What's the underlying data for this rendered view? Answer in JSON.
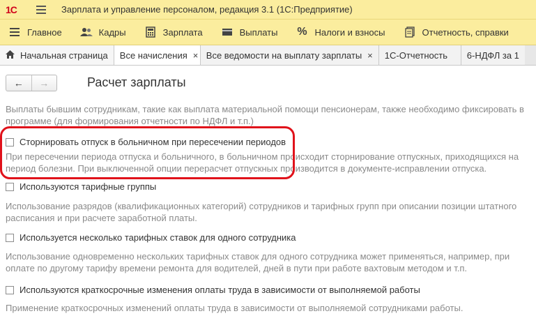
{
  "window": {
    "logo_text": "1С",
    "title": "Зарплата и управление персоналом, редакция 3.1  (1С:Предприятие)"
  },
  "menu": [
    {
      "label": "Главное",
      "icon": "hamburger-icon"
    },
    {
      "label": "Кадры",
      "icon": "users-icon"
    },
    {
      "label": "Зарплата",
      "icon": "calculator-icon"
    },
    {
      "label": "Выплаты",
      "icon": "wallet-icon"
    },
    {
      "label": "Налоги и взносы",
      "icon": "percent-icon"
    },
    {
      "label": "Отчетность, справки",
      "icon": "document-icon"
    }
  ],
  "tabs": [
    {
      "label": "Начальная страница",
      "icon": "home-icon"
    },
    {
      "label": "Все начисления",
      "close": "×"
    },
    {
      "label": "Все ведомости на выплату зарплаты",
      "close": "×"
    },
    {
      "label": "1С-Отчетность",
      "close": ""
    },
    {
      "label": "6-НДФЛ за 1",
      "close": ""
    }
  ],
  "nav": {
    "back": "←",
    "forward": "→"
  },
  "page_title": "Расчет зарплаты",
  "intro_text": "Выплаты бывшим сотрудникам, такие как выплата материальной помощи пенсионерам, также необходимо фиксировать в программе (для формирования отчетности по НДФЛ и т.п.)",
  "options": [
    {
      "label": "Сторнировать отпуск в больничном при пересечении периодов",
      "checked": false,
      "description": "При пересечении периода отпуска и больничного, в больничном происходит сторнирование отпускных, приходящихся на период болезни. При выключенной опции перерасчет отпускных производится в документе-исправлении отпуска."
    },
    {
      "label": "Используются тарифные группы",
      "checked": false,
      "description": "Использование разрядов (квалификационных категорий) сотрудников и тарифных групп при описании позиции штатного расписания и при расчете заработной платы."
    },
    {
      "label": "Используется несколько тарифных ставок для одного сотрудника",
      "checked": false,
      "description": "Использование одновременно нескольких тарифных ставок для одного сотрудника может применяться, например, при оплате по другому тарифу времени ремонта для водителей, дней в пути при работе вахтовым методом и т.п."
    },
    {
      "label": "Используются краткосрочные изменения оплаты труда в зависимости от выполняемой работы",
      "checked": false,
      "description": "Применение краткосрочных изменений оплаты труда в зависимости от выполняемой сотрудниками работы."
    }
  ],
  "colors": {
    "header_bg": "#fbed9e",
    "highlight": "#e0121b",
    "logo": "#d0021b"
  }
}
